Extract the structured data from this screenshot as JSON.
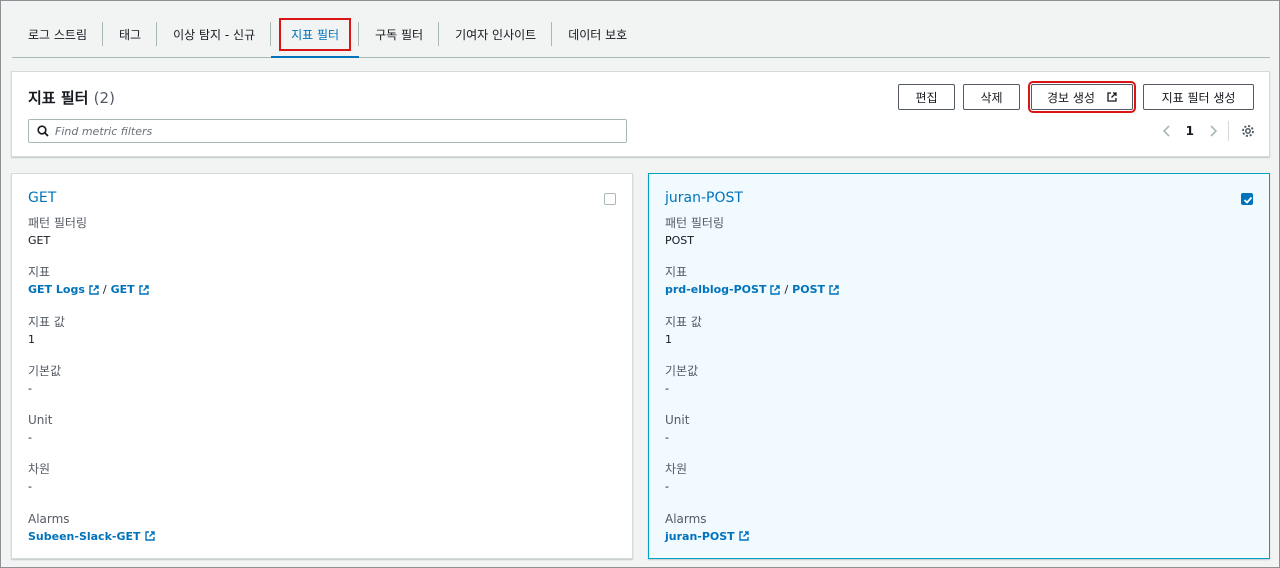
{
  "tabs": [
    {
      "label": "로그 스트림"
    },
    {
      "label": "태그"
    },
    {
      "label": "이상 탐지 - 신규"
    },
    {
      "label": "지표 필터"
    },
    {
      "label": "구독 필터"
    },
    {
      "label": "기여자 인사이트"
    },
    {
      "label": "데이터 보호"
    }
  ],
  "header": {
    "title": "지표 필터",
    "count": "(2)",
    "search_placeholder": "Find metric filters",
    "buttons": {
      "edit": "편집",
      "delete": "삭제",
      "create_alarm": "경보 생성",
      "create_filter": "지표 필터 생성"
    },
    "page": "1"
  },
  "cards": [
    {
      "title": "GET",
      "checked": false,
      "pattern_label": "패턴 필터링",
      "pattern": "GET",
      "metric_label": "지표",
      "metric_ns": "GET Logs",
      "metric_name": "GET",
      "value_label": "지표 값",
      "value": "1",
      "default_label": "기본값",
      "default": "-",
      "unit_label": "Unit",
      "unit": "-",
      "dimension_label": "차원",
      "dimension": "-",
      "alarms_label": "Alarms",
      "alarm": "Subeen-Slack-GET"
    },
    {
      "title": "juran-POST",
      "checked": true,
      "pattern_label": "패턴 필터링",
      "pattern": "POST",
      "metric_label": "지표",
      "metric_ns": "prd-elblog-POST",
      "metric_name": "POST",
      "value_label": "지표 값",
      "value": "1",
      "default_label": "기본값",
      "default": "-",
      "unit_label": "Unit",
      "unit": "-",
      "dimension_label": "차원",
      "dimension": "-",
      "alarms_label": "Alarms",
      "alarm": "juran-POST"
    }
  ],
  "colors": {
    "link": "#0073bb",
    "highlight": "#d91515",
    "selected_bg": "#f1faff",
    "selected_border": "#00a1c9"
  }
}
